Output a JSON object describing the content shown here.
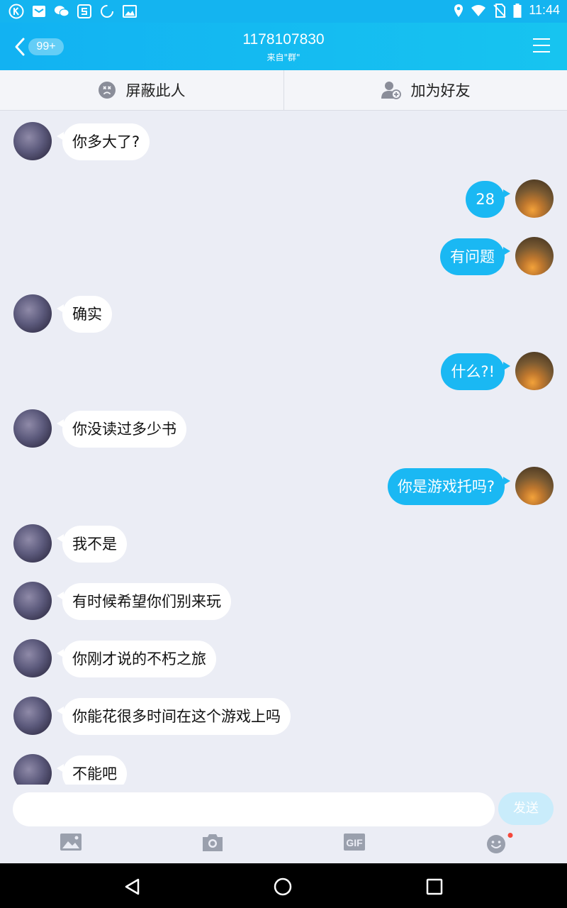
{
  "status_bar": {
    "time": "11:44"
  },
  "header": {
    "unread_badge": "99+",
    "title": "1178107830",
    "subtitle": "来自\"群\""
  },
  "actions": {
    "block_label": "屏蔽此人",
    "add_friend_label": "加为好友"
  },
  "messages": [
    {
      "sender": "other",
      "text": "你多大了?"
    },
    {
      "sender": "self",
      "text": "28"
    },
    {
      "sender": "self",
      "text": "有问题"
    },
    {
      "sender": "other",
      "text": "确实"
    },
    {
      "sender": "self",
      "text": "什么?!"
    },
    {
      "sender": "other",
      "text": "你没读过多少书"
    },
    {
      "sender": "self",
      "text": "你是游戏托吗?"
    },
    {
      "sender": "other",
      "text": "我不是"
    },
    {
      "sender": "other",
      "text": "有时候希望你们别来玩"
    },
    {
      "sender": "other",
      "text": "你刚才说的不朽之旅"
    },
    {
      "sender": "other",
      "text": "你能花很多时间在这个游戏上吗"
    },
    {
      "sender": "other",
      "text": "不能吧"
    }
  ],
  "composer": {
    "value": "",
    "placeholder": "",
    "send_label": "发送"
  },
  "toolbar": {
    "gif_label": "GIF"
  },
  "colors": {
    "accent": "#14b4f0",
    "self_bubble": "#1ab8f3",
    "background": "#ebedf5"
  }
}
